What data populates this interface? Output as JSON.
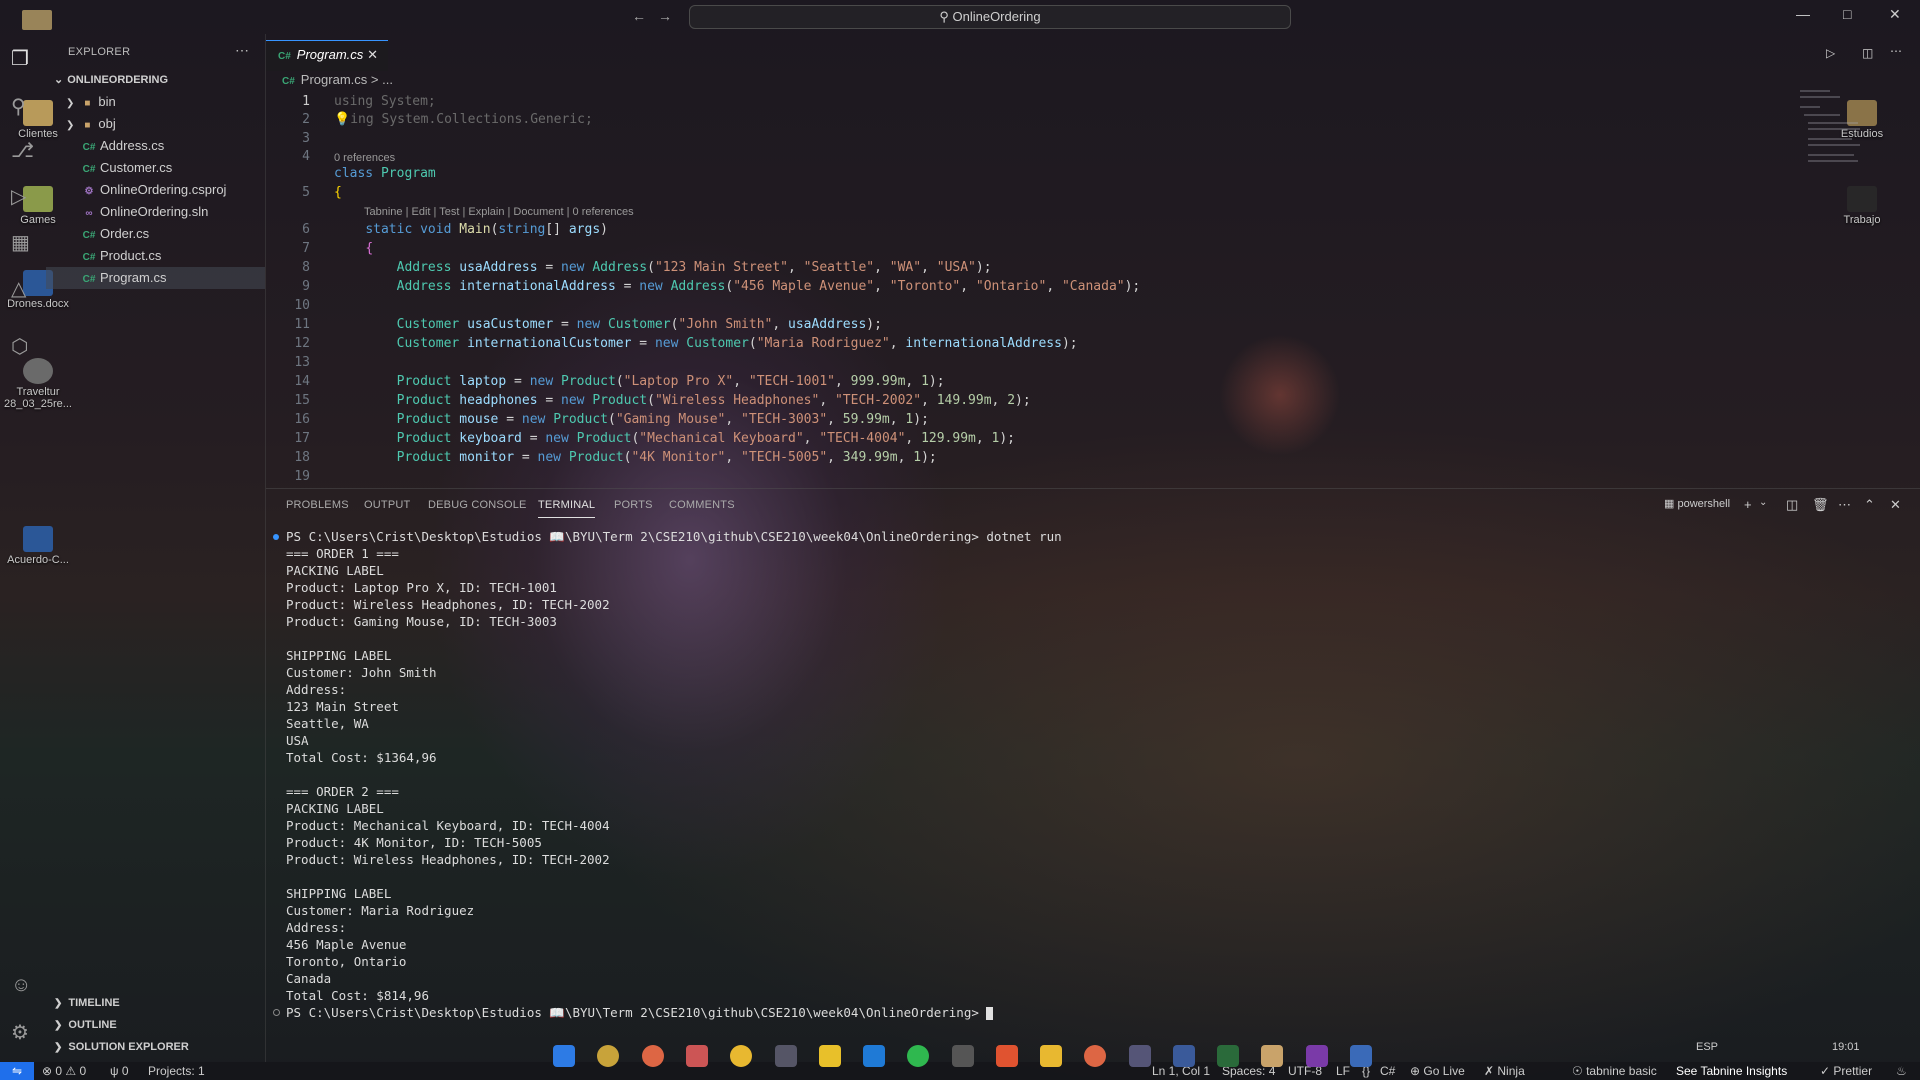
{
  "titlebar": {
    "search_text": "OnlineOrdering",
    "nav_back": "←",
    "nav_forward": "→"
  },
  "desktop_icons": [
    {
      "label": "Clientes"
    },
    {
      "label": "Games"
    },
    {
      "label": "Drones.docx"
    },
    {
      "label": "Traveltur 28_03_25re..."
    },
    {
      "label": "Acuerdo-C..."
    },
    {
      "label": "Estudios"
    },
    {
      "label": "Trabajo"
    }
  ],
  "sidebar": {
    "title": "EXPLORER",
    "project": "ONLINEORDERING",
    "items": [
      {
        "label": "bin",
        "kind": "folder"
      },
      {
        "label": "obj",
        "kind": "folder"
      },
      {
        "label": "Address.cs",
        "kind": "cs"
      },
      {
        "label": "Customer.cs",
        "kind": "cs"
      },
      {
        "label": "OnlineOrdering.csproj",
        "kind": "csproj"
      },
      {
        "label": "OnlineOrdering.sln",
        "kind": "sln"
      },
      {
        "label": "Order.cs",
        "kind": "cs"
      },
      {
        "label": "Product.cs",
        "kind": "cs"
      },
      {
        "label": "Program.cs",
        "kind": "cs",
        "selected": true
      }
    ],
    "sections": [
      "TIMELINE",
      "OUTLINE",
      "SOLUTION EXPLORER"
    ]
  },
  "editor": {
    "tab_label": "Program.cs",
    "breadcrumb_file": "Program.cs",
    "breadcrumb_rest": "> ...",
    "codelens_refs": "0 references",
    "codelens_main": "Tabnine | Edit | Test | Explain | Document | 0 references",
    "line_numbers": [
      "1",
      "2",
      "3",
      "4",
      "5",
      "6",
      "7",
      "8",
      "9",
      "10",
      "11",
      "12",
      "13",
      "14",
      "15",
      "16",
      "17",
      "18",
      "19"
    ]
  },
  "panel": {
    "tabs": [
      "PROBLEMS",
      "OUTPUT",
      "DEBUG CONSOLE",
      "TERMINAL",
      "PORTS",
      "COMMENTS"
    ],
    "active_tab": "TERMINAL",
    "shell": "powershell",
    "terminal_lines": [
      "PS C:\\Users\\Crist\\Desktop\\Estudios 📖\\BYU\\Term 2\\CSE210\\github\\CSE210\\week04\\OnlineOrdering> dotnet run",
      "=== ORDER 1 ===",
      "PACKING LABEL",
      "Product: Laptop Pro X, ID: TECH-1001",
      "Product: Wireless Headphones, ID: TECH-2002",
      "Product: Gaming Mouse, ID: TECH-3003",
      "",
      "SHIPPING LABEL",
      "Customer: John Smith",
      "Address:",
      "123 Main Street",
      "Seattle, WA",
      "USA",
      "Total Cost: $1364,96",
      "",
      "=== ORDER 2 ===",
      "PACKING LABEL",
      "Product: Mechanical Keyboard, ID: TECH-4004",
      "Product: 4K Monitor, ID: TECH-5005",
      "Product: Wireless Headphones, ID: TECH-2002",
      "",
      "SHIPPING LABEL",
      "Customer: Maria Rodriguez",
      "Address:",
      "456 Maple Avenue",
      "Toronto, Ontario",
      "Canada",
      "Total Cost: $814,96",
      "PS C:\\Users\\Crist\\Desktop\\Estudios 📖\\BYU\\Term 2\\CSE210\\github\\CSE210\\week04\\OnlineOrdering> "
    ]
  },
  "statusbar": {
    "errors": "0",
    "warnings": "0",
    "ports": "0",
    "projects": "Projects: 1",
    "position": "Ln 1, Col 1",
    "spaces": "Spaces: 4",
    "encoding": "UTF-8",
    "eol": "LF",
    "braces": "{}",
    "language": "C#",
    "golive": "Go Live",
    "ninja": "Ninja",
    "tabnine": "tabnine basic",
    "insights": "See Tabnine Insights",
    "prettier": "Prettier",
    "lang_ind": "ESP",
    "time": "19:01"
  },
  "colors": {
    "accent": "#3794ff",
    "keyword": "#569cd6",
    "type": "#4ec9b0",
    "string": "#ce9178",
    "number": "#b5cea8",
    "csharp": "#3aa675"
  }
}
